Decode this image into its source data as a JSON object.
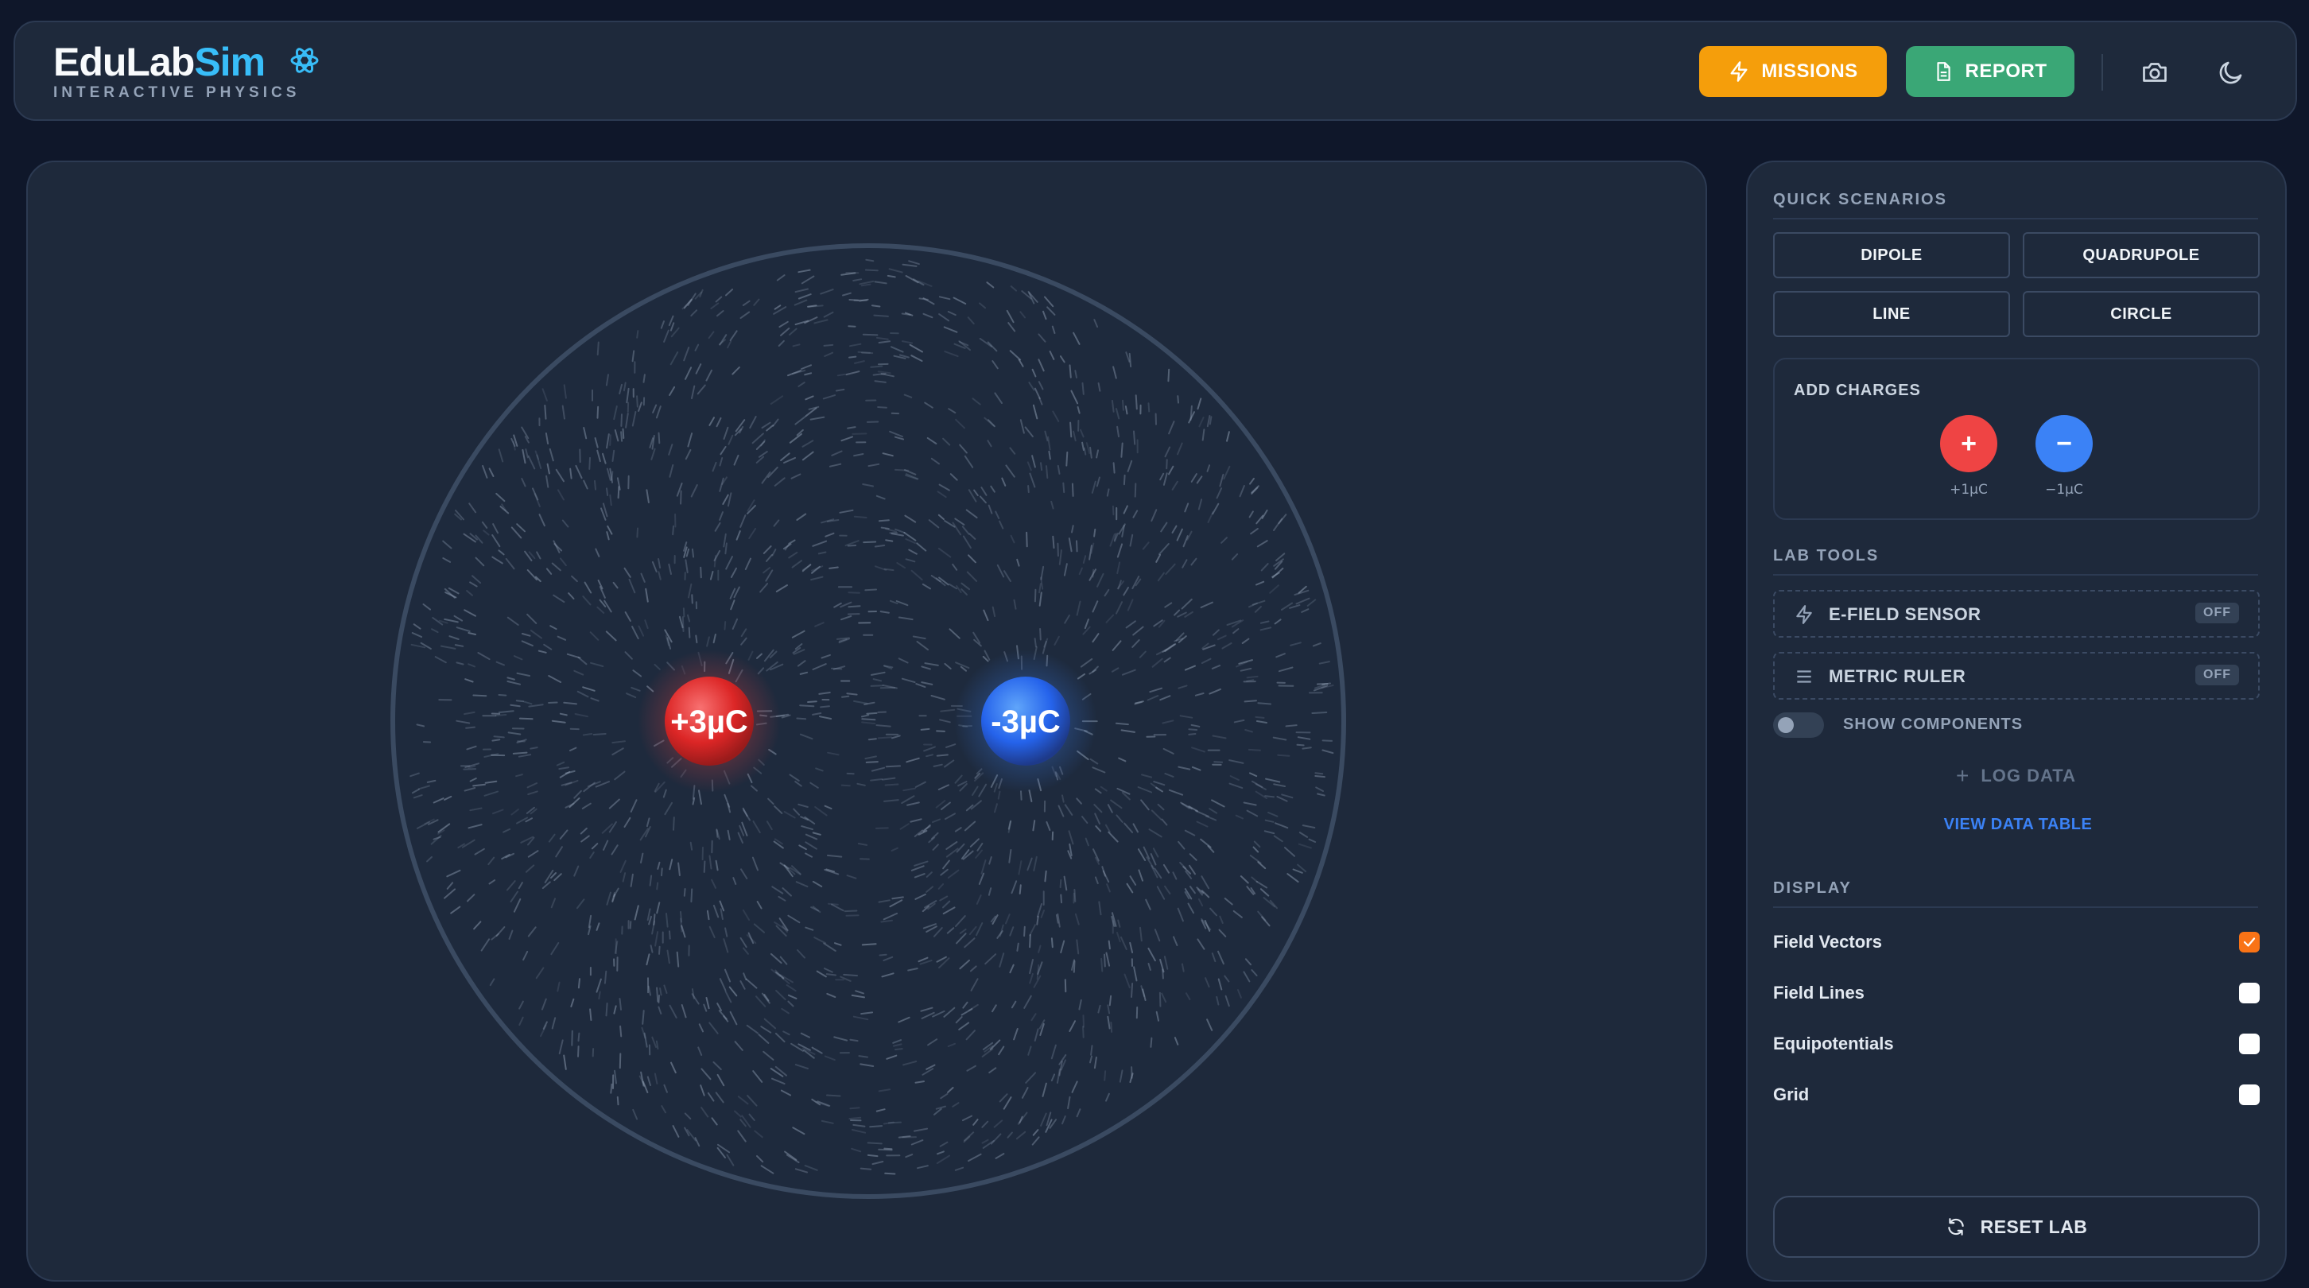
{
  "header": {
    "logo_part1": "EduLab",
    "logo_part2": "Sim",
    "logo_subtitle": "INTERACTIVE PHYSICS",
    "missions_label": "MISSIONS",
    "report_label": "REPORT",
    "icons": [
      "bolt-icon",
      "document-icon",
      "camera-icon",
      "moon-icon",
      "atom-icon"
    ]
  },
  "simulation": {
    "charges": [
      {
        "label": "+3µC",
        "sign": "positive",
        "color": "#ef4444"
      },
      {
        "label": "-3µC",
        "sign": "negative",
        "color": "#2563eb"
      }
    ],
    "boundary": "circle"
  },
  "sidebar": {
    "quick_scenarios_title": "QUICK SCENARIOS",
    "scenarios": [
      "DIPOLE",
      "QUADRUPOLE",
      "LINE",
      "CIRCLE"
    ],
    "add_charges_title": "ADD CHARGES",
    "add_positive": {
      "symbol": "+",
      "label": "+1µC",
      "color": "#ef4444"
    },
    "add_negative": {
      "symbol": "−",
      "label": "−1µC",
      "color": "#3b82f6"
    },
    "lab_tools_title": "LAB TOOLS",
    "tools": [
      {
        "label": "E-FIELD SENSOR",
        "state": "OFF",
        "icon": "bolt-icon"
      },
      {
        "label": "METRIC RULER",
        "state": "OFF",
        "icon": "ruler-icon"
      }
    ],
    "show_components_label": "SHOW COMPONENTS",
    "show_components_on": false,
    "log_data_label": "LOG DATA",
    "view_data_table_label": "VIEW DATA TABLE",
    "display_title": "DISPLAY",
    "display_options": [
      {
        "label": "Field Vectors",
        "checked": true
      },
      {
        "label": "Field Lines",
        "checked": false
      },
      {
        "label": "Equipotentials",
        "checked": false
      },
      {
        "label": "Grid",
        "checked": false
      }
    ],
    "reset_label": "RESET LAB"
  },
  "colors": {
    "background": "#0f172a",
    "panel": "#1e293b",
    "missions": "#f59e0b",
    "report": "#3aa776",
    "link": "#3b82f6",
    "checkbox_checked": "#f97316"
  }
}
